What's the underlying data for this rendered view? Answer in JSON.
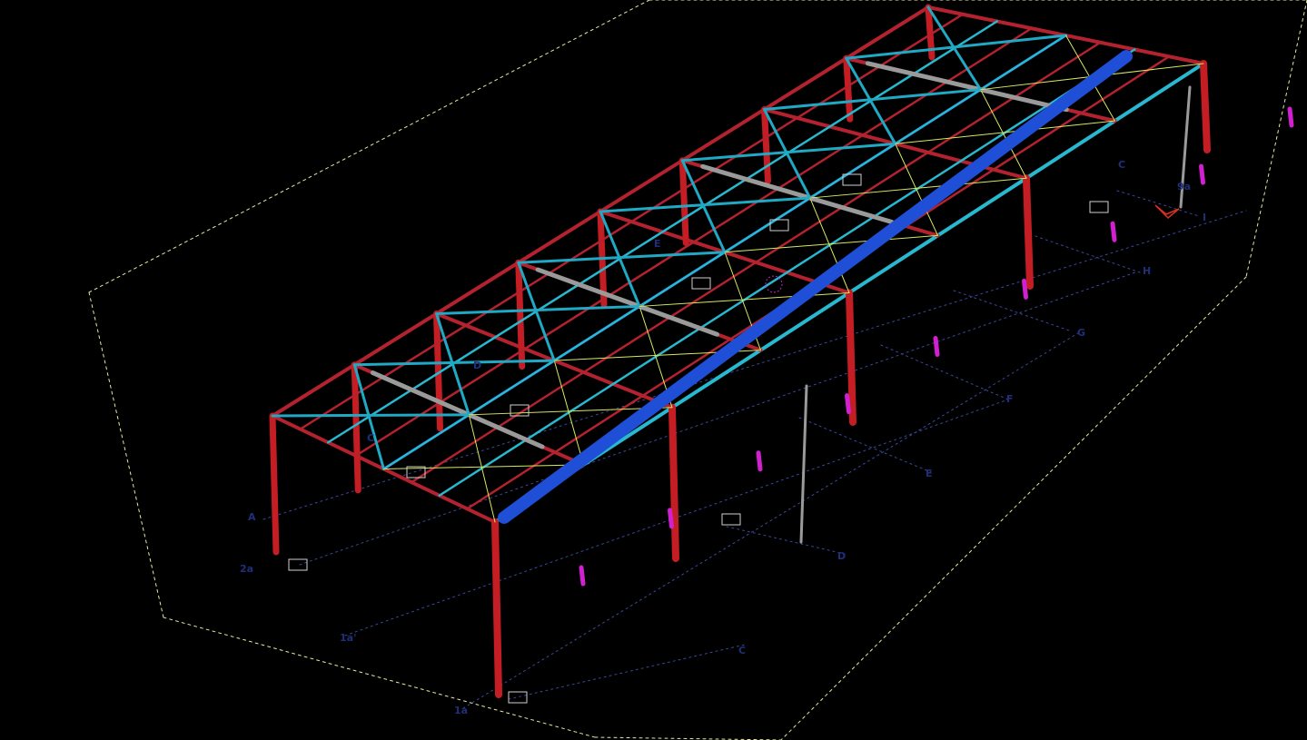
{
  "view": {
    "title": "",
    "background": "#000000",
    "colors": {
      "rafter": "#b3222e",
      "column": "#c41e24",
      "purlin": "#28b8d0",
      "bracing": "#1fa9c4",
      "beam": "#1e4fd6",
      "tie": "#d8e860",
      "eave_gray": "#9a9a9a",
      "marker": "#d020d0",
      "axis_label": "#1f2f7a",
      "bbox": "#e8e8a0"
    }
  },
  "grid_labels": {
    "A": "A",
    "C_top": "C",
    "D_top": "D",
    "E_top": "E",
    "2a": "2a",
    "1a_prime": "1a'",
    "1a": "1a",
    "C": "C",
    "D": "D",
    "E": "E",
    "F": "F",
    "G": "G",
    "H": "H",
    "I": "I",
    "9a": "9a",
    "C_right": "C"
  },
  "icons": {
    "ucs": "ucs-axis-icon",
    "selection": "selection-marker-icon"
  }
}
